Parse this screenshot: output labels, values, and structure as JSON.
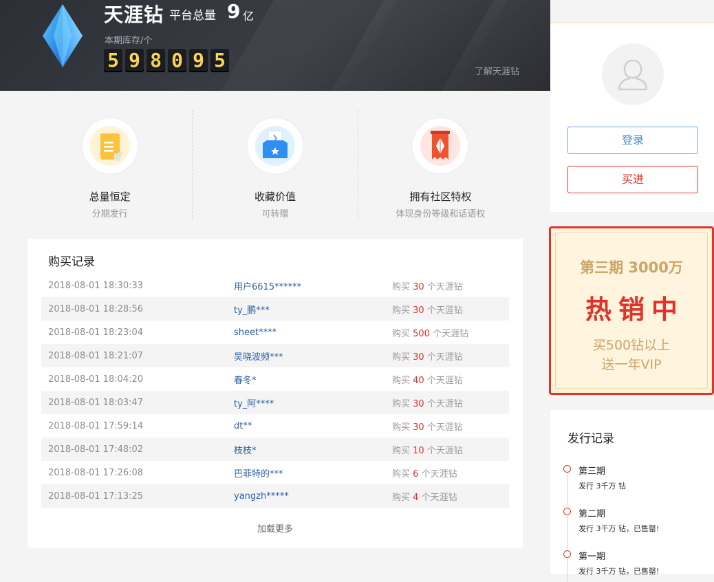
{
  "header": {
    "brand": "天涯钻",
    "total_label": "平台总量",
    "total_value": "9",
    "total_unit": "亿",
    "stock_label": "本期库存/个",
    "stock_digits": [
      "5",
      "9",
      "8",
      "0",
      "9",
      "5"
    ],
    "learn_link": "了解天涯钻"
  },
  "features": [
    {
      "title": "总量恒定",
      "subtitle": "分期发行",
      "icon": "ticket-icon"
    },
    {
      "title": "收藏价值",
      "subtitle": "可转赠",
      "icon": "gift-box-icon"
    },
    {
      "title": "拥有社区特权",
      "subtitle": "体现身份等级和话语权",
      "icon": "diamond-banner-icon"
    }
  ],
  "records": {
    "title": "购买记录",
    "buy_prefix": "购买",
    "buy_suffix": "个天涯钻",
    "rows": [
      {
        "time": "2018-08-01 18:30:33",
        "user": "用户6615******",
        "count": "30"
      },
      {
        "time": "2018-08-01 18:28:56",
        "user": "ty_鹏***",
        "count": "30"
      },
      {
        "time": "2018-08-01 18:23:04",
        "user": "sheet****",
        "count": "500"
      },
      {
        "time": "2018-08-01 18:21:07",
        "user": "吴晓波频***",
        "count": "30"
      },
      {
        "time": "2018-08-01 18:04:20",
        "user": "春冬*",
        "count": "40"
      },
      {
        "time": "2018-08-01 18:03:47",
        "user": "ty_阿****",
        "count": "30"
      },
      {
        "time": "2018-08-01 17:59:14",
        "user": "dt**",
        "count": "30"
      },
      {
        "time": "2018-08-01 17:48:02",
        "user": "枝枝*",
        "count": "10"
      },
      {
        "time": "2018-08-01 17:26:08",
        "user": "巴菲特的***",
        "count": "6"
      },
      {
        "time": "2018-08-01 17:13:25",
        "user": "yangzh*****",
        "count": "4"
      }
    ],
    "load_more": "加载更多"
  },
  "user_panel": {
    "login_label": "登录",
    "buy_label": "买进"
  },
  "promo": {
    "period": "第三期 3000万",
    "hot": "热销中",
    "line1": "买500钻以上",
    "line2": "送一年VIP"
  },
  "issues": {
    "title": "发行记录",
    "items": [
      {
        "name": "第三期",
        "desc": "发行 3千万 钻"
      },
      {
        "name": "第二期",
        "desc": "发行 3千万 钻，已售罄!"
      },
      {
        "name": "第一期",
        "desc": "发行 3千万 钻，已售罄!"
      }
    ]
  },
  "colors": {
    "accent_red": "#e0332b",
    "link_blue": "#2c5fa3",
    "digit_yellow": "#f8d45a",
    "promo_gold": "#c9a56a"
  }
}
